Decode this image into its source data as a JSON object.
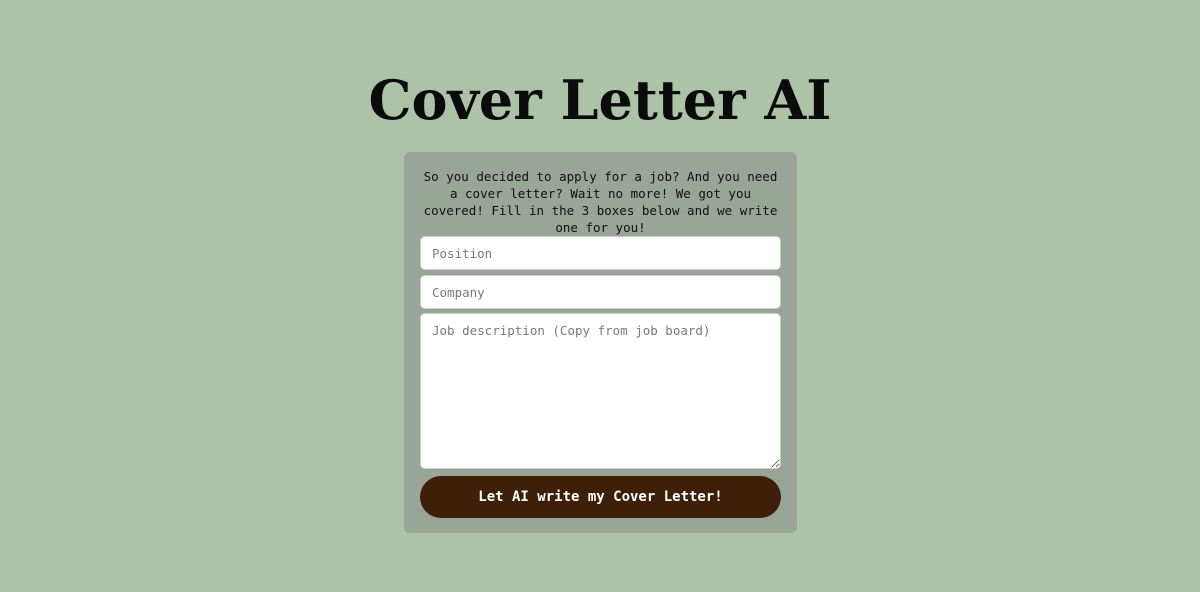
{
  "header": {
    "title": "Cover Letter AI"
  },
  "form": {
    "intro": "So you decided to apply for a job? And you need a cover letter? Wait no more! We got you covered! Fill in the 3 boxes below and we write one for you!",
    "position_placeholder": "Position",
    "company_placeholder": "Company",
    "description_placeholder": "Job description (Copy from job board)",
    "submit_label": "Let AI write my Cover Letter!"
  },
  "colors": {
    "background": "#adc3a8",
    "card": "#98a597",
    "button": "#3e1f09",
    "button_text": "#ffffff"
  }
}
